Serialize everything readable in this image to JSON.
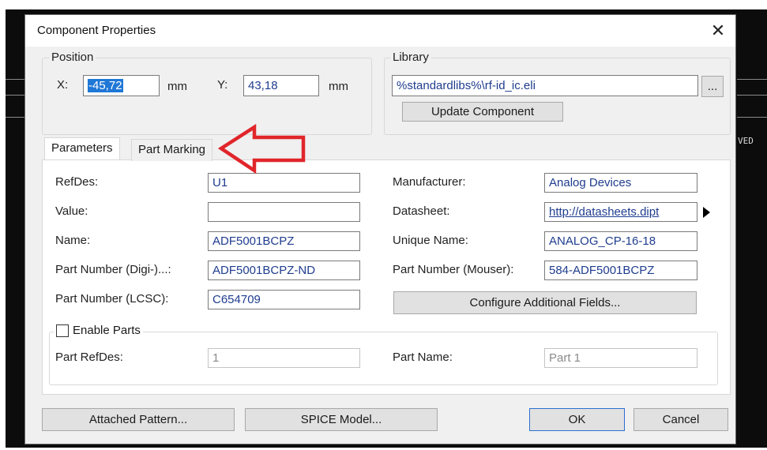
{
  "dialog": {
    "title": "Component Properties",
    "close_glyph": "✕"
  },
  "background": {
    "side_text": "VED"
  },
  "position": {
    "legend": "Position",
    "x_label": "X:",
    "x_value": "-45,72",
    "x_unit": "mm",
    "y_label": "Y:",
    "y_value": "43,18",
    "y_unit": "mm"
  },
  "library": {
    "legend": "Library",
    "path": "%standardlibs%\\rf-id_ic.eli",
    "browse_label": "...",
    "update_label": "Update Component"
  },
  "tabs": [
    {
      "label": "Parameters",
      "active": true
    },
    {
      "label": "Part Marking",
      "active": false
    }
  ],
  "params_left": [
    {
      "label": "RefDes:",
      "value": "U1"
    },
    {
      "label": "Value:",
      "value": ""
    },
    {
      "label": "Name:",
      "value": "ADF5001BCPZ"
    },
    {
      "label": "Part Number (Digi-)...:",
      "value": "ADF5001BCPZ-ND"
    },
    {
      "label": "Part Number (LCSC):",
      "value": "C654709"
    }
  ],
  "params_right": [
    {
      "label": "Manufacturer:",
      "value": "Analog Devices"
    },
    {
      "label": "Datasheet:",
      "value": "http://datasheets.dipt"
    },
    {
      "label": "Unique Name:",
      "value": "ANALOG_CP-16-18"
    },
    {
      "label": "Part Number (Mouser):",
      "value": "584-ADF5001BCPZ"
    }
  ],
  "configure_label": "Configure Additional Fields...",
  "parts": {
    "enable_label": "Enable Parts",
    "enabled": false,
    "refdes_label": "Part RefDes:",
    "refdes_value": "1",
    "name_label": "Part Name:",
    "name_value": "Part 1"
  },
  "footer": {
    "attached_pattern": "Attached Pattern...",
    "spice_model": "SPICE Model...",
    "ok": "OK",
    "cancel": "Cancel"
  },
  "colors": {
    "annotation_arrow": "#e0262b",
    "selection": "#1f77d6",
    "value_text": "#1f3d8f"
  }
}
